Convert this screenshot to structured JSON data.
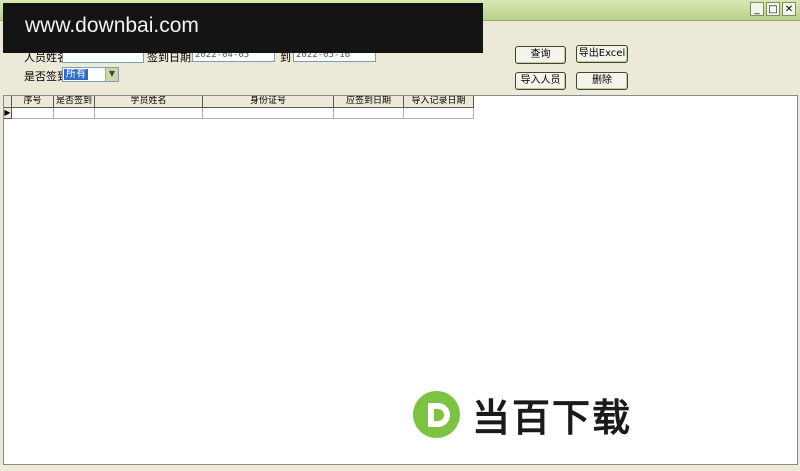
{
  "watermark": {
    "text": "www.downbai.com"
  },
  "window": {
    "minimize_glyph": "_",
    "maximize_glyph": "□",
    "close_glyph": "✕"
  },
  "form": {
    "name_label": "人员姓名",
    "name_value": "",
    "date_from_label": "签到日期从",
    "date_from_value": "2022-04-05",
    "date_to_label": "到",
    "date_to_value": "2022-05-16",
    "signed_label": "是否签到",
    "signed_value": "所有"
  },
  "buttons": {
    "query": "查询",
    "export_excel": "导出Excel",
    "import_people": "导入人员",
    "delete": "删除"
  },
  "grid": {
    "columns": [
      "序号",
      "是否签到",
      "学员姓名",
      "身份证号",
      "应签到日期",
      "导入记录日期"
    ],
    "row_indicator": "▶"
  },
  "logo": {
    "text": "当百下载",
    "mark": "D"
  },
  "colors": {
    "logo_green": "#7dc243",
    "selection_blue": "#316ac5"
  }
}
